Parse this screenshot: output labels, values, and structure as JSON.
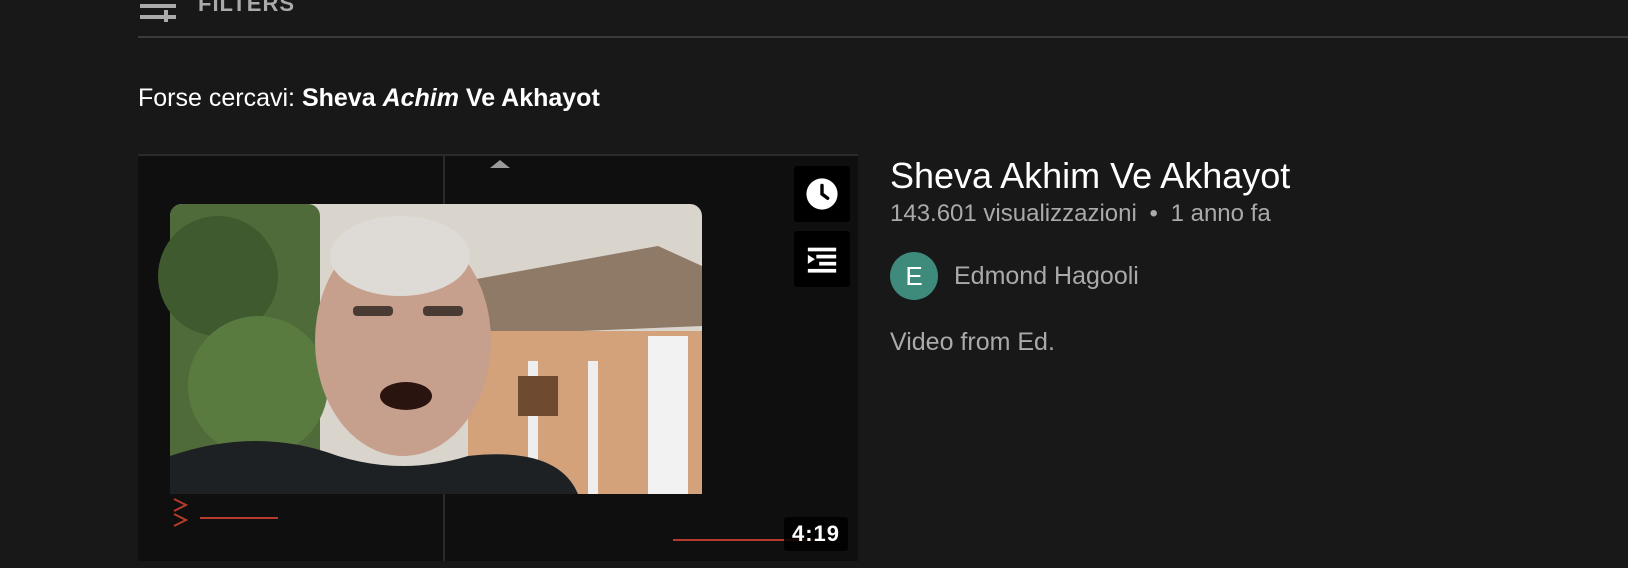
{
  "header": {
    "filters_label": "FILTERS",
    "filters_icon": "filter-sliders-icon"
  },
  "suggestion": {
    "prefix": "Forse cercavi:",
    "query_part1": "Sheva",
    "query_part2": "Achim",
    "query_part3": "Ve Akhayot"
  },
  "video": {
    "title": "Sheva Akhim Ve Akhayot",
    "views": "143.601 visualizzazioni",
    "separator": "•",
    "age": "1 anno fa",
    "duration": "4:19",
    "watch_later_icon": "clock-icon",
    "add_to_queue_icon": "add-to-queue-icon",
    "channel": {
      "avatar_letter": "E",
      "avatar_color": "#3e8a7b",
      "name": "Edmond Hagooli"
    },
    "description": "Video from Ed."
  },
  "colors": {
    "background": "#181818",
    "primary_text": "#ffffff",
    "secondary_text": "#aaaaaa"
  }
}
